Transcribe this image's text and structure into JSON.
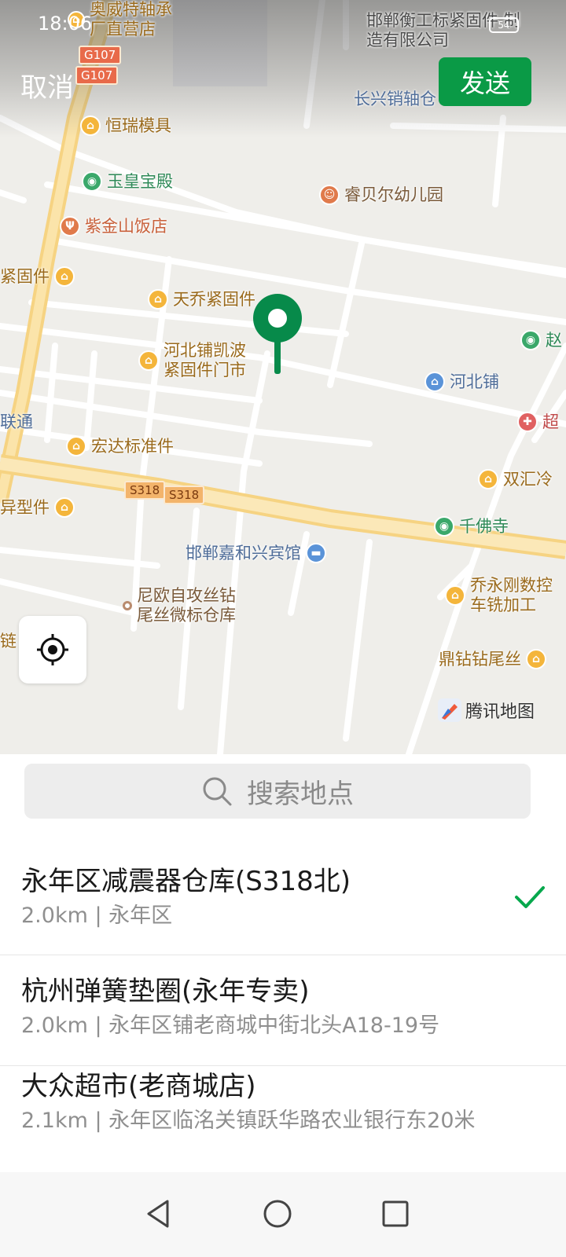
{
  "status": {
    "time": "18:06",
    "battery": "54"
  },
  "header": {
    "cancel_label": "取消",
    "send_label": "发送"
  },
  "map": {
    "pois": [
      {
        "label": "奥威特轴承 厂直营店",
        "icon": "bearing-shop-icon"
      },
      {
        "label": "邯郸衡工标紧固件 制造有限公司",
        "icon": "factory-icon"
      },
      {
        "label": "长兴销轴仓",
        "icon": "warehouse-icon"
      },
      {
        "label": "恒瑞模具",
        "icon": "shop-icon"
      },
      {
        "label": "玉皇宝殿",
        "icon": "temple-icon"
      },
      {
        "label": "睿贝尔幼儿园",
        "icon": "kindergarten-icon"
      },
      {
        "label": "紫金山饭店",
        "icon": "restaurant-icon"
      },
      {
        "label": "紧固件",
        "icon": "shop-icon"
      },
      {
        "label": "天乔紧固件",
        "icon": "shop-icon"
      },
      {
        "label": "河北铺凯波 紧固件门市",
        "icon": "shop-icon"
      },
      {
        "label": "河北铺",
        "icon": "village-icon"
      },
      {
        "label": "联通",
        "icon": "telecom-icon"
      },
      {
        "label": "宏达标准件",
        "icon": "shop-icon"
      },
      {
        "label": "双汇冷",
        "icon": "shop-icon"
      },
      {
        "label": "异型件",
        "icon": "shop-icon"
      },
      {
        "label": "千佛寺",
        "icon": "temple-icon"
      },
      {
        "label": "邯郸嘉和兴宾馆",
        "icon": "hotel-icon"
      },
      {
        "label": "乔永刚数控 车铣加工",
        "icon": "shop-icon"
      },
      {
        "label": "尼欧自攻丝钻 尾丝微标仓库",
        "icon": "warehouse-dot-icon"
      },
      {
        "label": "链",
        "icon": ""
      },
      {
        "label": "鼎钻钻尾丝",
        "icon": "shop-icon"
      },
      {
        "label": "赵",
        "icon": "temple-icon"
      },
      {
        "label": "超",
        "icon": "supermarket-icon"
      }
    ],
    "road_shields": [
      "G107",
      "G107",
      "S318",
      "S318"
    ],
    "attribution": "腾讯地图"
  },
  "search": {
    "placeholder": "搜索地点"
  },
  "results": [
    {
      "title": "永年区减震器仓库(S318北)",
      "subtitle": "2.0km | 永年区",
      "selected": true
    },
    {
      "title": "杭州弹簧垫圈(永年专卖)",
      "subtitle": "2.0km | 永年区铺老商城中街北头A18-19号",
      "selected": false
    },
    {
      "title": "大众超市(老商城店)",
      "subtitle": "2.1km | 永年区临洺关镇跃华路农业银行东20米",
      "selected": false
    }
  ],
  "colors": {
    "accent": "#07a84d",
    "send_button": "#0a9a46",
    "checkmark": "#07a84d"
  }
}
